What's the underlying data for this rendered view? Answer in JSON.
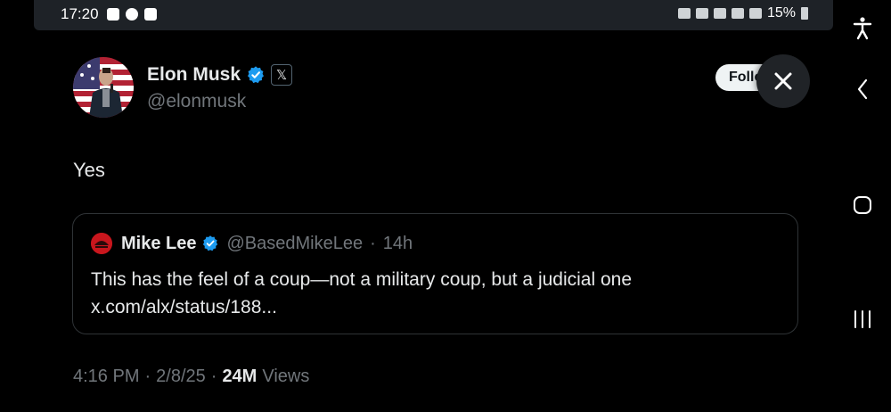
{
  "status_bar": {
    "time": "17:20",
    "battery": "15%",
    "left_icons": [
      "alert-icon",
      "do-not-disturb-icon",
      "image-icon"
    ],
    "right_icons": [
      "key-icon",
      "alarm-icon",
      "mute-icon",
      "wifi-icon",
      "signal-icon",
      "battery-icon"
    ]
  },
  "tweet": {
    "author_name": "Elon Musk",
    "author_handle": "@elonmusk",
    "follow_label": "Follo",
    "text": "Yes",
    "timestamp": "4:16 PM",
    "date": "2/8/25",
    "views_count": "24M",
    "views_label": "Views"
  },
  "quote": {
    "author_name": "Mike Lee",
    "author_handle": "@BasedMikeLee",
    "age": "14h",
    "text": "This has the feel of a coup—not a military coup, but a judicial one x.com/alx/status/188..."
  },
  "navigation": {
    "icons": [
      "accessibility-icon",
      "back-icon",
      "home-icon",
      "recents-icon"
    ]
  },
  "colors": {
    "background": "#000000",
    "text_primary": "#e7e9ea",
    "text_secondary": "#71767b",
    "verified": "#1d9bf0",
    "border": "#2f3336"
  }
}
